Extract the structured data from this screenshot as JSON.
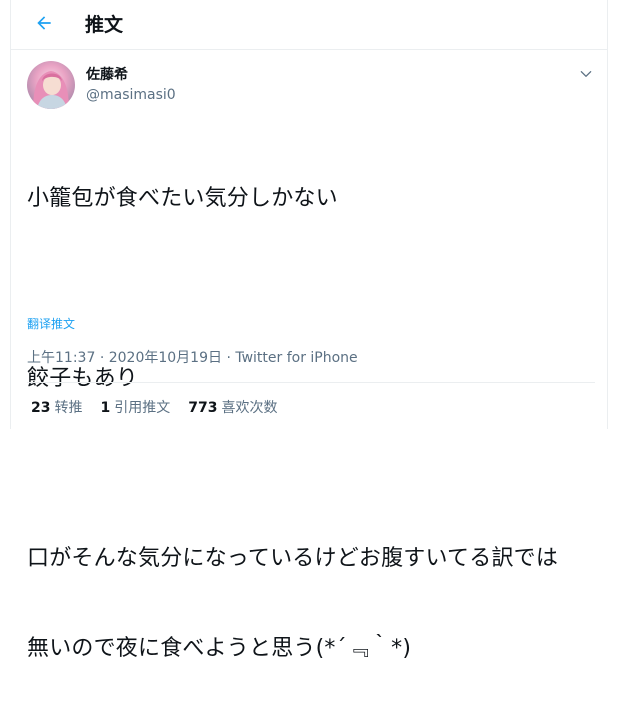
{
  "header": {
    "title": "推文",
    "back_icon": "arrow-left-icon",
    "accent": "#1da1f2"
  },
  "tweet": {
    "author_name": "佐藤希",
    "author_handle": "@masimasi0",
    "avatar_icon": "avatar",
    "more_icon": "chevron-down-icon",
    "lines": [
      "小籠包が食べたい気分しかない",
      "",
      "餃子もあり",
      "",
      "口がそんな気分になっているけどお腹すいてる訳では",
      "無いので夜に食べようと思う(*´﹃｀*)"
    ],
    "translate_label": "翻译推文",
    "time": "上午11:37",
    "separator": "·",
    "date": "2020年10月19日",
    "source": "Twitter for iPhone"
  },
  "stats": [
    {
      "count": "23",
      "label": "转推"
    },
    {
      "count": "1",
      "label": "引用推文"
    },
    {
      "count": "773",
      "label": "喜欢次数"
    }
  ]
}
